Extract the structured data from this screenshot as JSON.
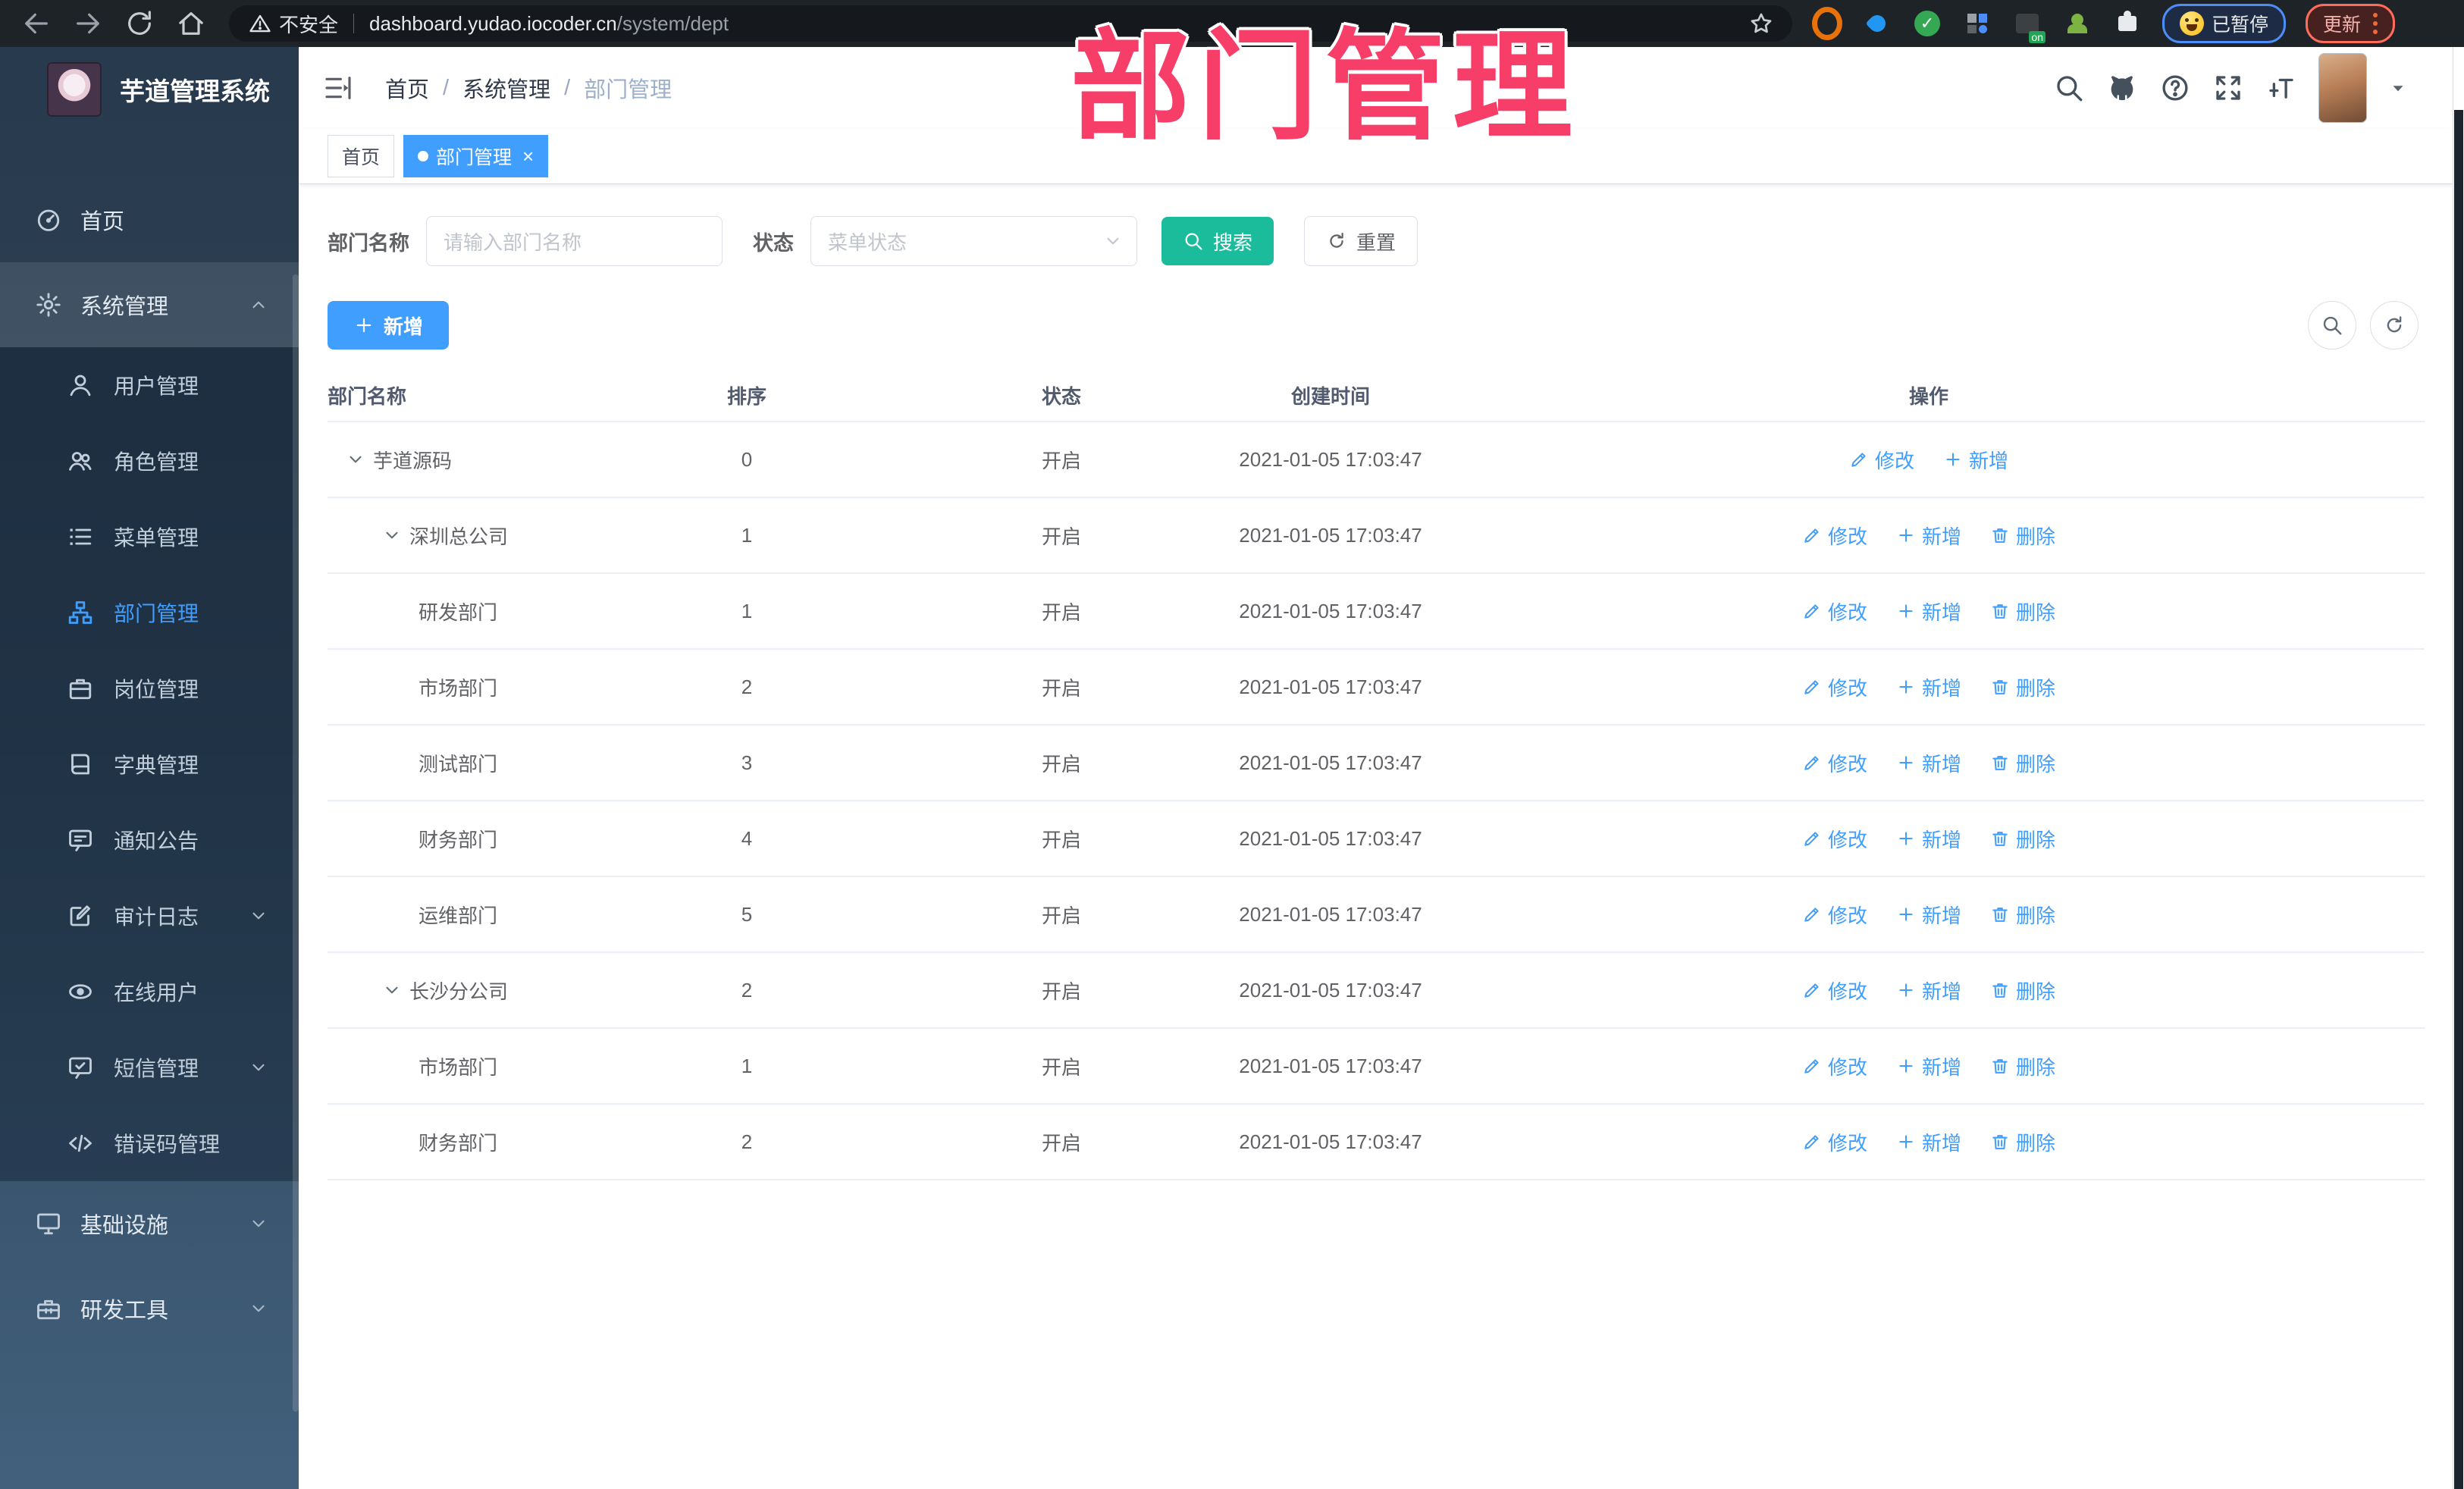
{
  "browser": {
    "security_label": "不安全",
    "url_host": "dashboard.yudao.iocoder.cn",
    "url_path": "/system/dept",
    "profile_chip_label": "已暂停",
    "update_button_label": "更新",
    "extensions": [
      {
        "name": "target-extension-icon",
        "kind": "target",
        "color": "#e8710a"
      },
      {
        "name": "drop-extension-icon",
        "kind": "drop",
        "color": "#2196f3"
      },
      {
        "name": "check-circle-extension-icon",
        "kind": "check",
        "color": "#34a853"
      },
      {
        "name": "grid-extension-icon",
        "kind": "grid",
        "color": "#9aa0a6"
      },
      {
        "name": "switch-extension-icon",
        "kind": "onbadge",
        "badge": "on",
        "color": "#21a453"
      },
      {
        "name": "person-extension-icon",
        "kind": "person",
        "color": "#7cb342"
      },
      {
        "name": "puzzle-extension-icon",
        "kind": "puzzle",
        "color": "#e8eaed"
      }
    ]
  },
  "annotation": {
    "text": "部门管理",
    "color": "#f63e68"
  },
  "sidebar": {
    "title": "芋道管理系统",
    "items": [
      {
        "label": "首页",
        "icon": "dashboard",
        "type": "root"
      },
      {
        "label": "系统管理",
        "icon": "gear",
        "type": "root",
        "section": true,
        "chevron": "up"
      },
      {
        "label": "用户管理",
        "icon": "user",
        "type": "sub"
      },
      {
        "label": "角色管理",
        "icon": "users",
        "type": "sub"
      },
      {
        "label": "菜单管理",
        "icon": "menulist",
        "type": "sub"
      },
      {
        "label": "部门管理",
        "icon": "orgtree",
        "type": "sub",
        "active": true
      },
      {
        "label": "岗位管理",
        "icon": "briefcase",
        "type": "sub"
      },
      {
        "label": "字典管理",
        "icon": "book",
        "type": "sub"
      },
      {
        "label": "通知公告",
        "icon": "chat",
        "type": "sub"
      },
      {
        "label": "审计日志",
        "icon": "edit",
        "type": "sub",
        "chevron": "down"
      },
      {
        "label": "在线用户",
        "icon": "eye",
        "type": "sub"
      },
      {
        "label": "短信管理",
        "icon": "sms",
        "type": "sub",
        "chevron": "down"
      },
      {
        "label": "错误码管理",
        "icon": "code",
        "type": "sub"
      },
      {
        "label": "基础设施",
        "icon": "monitor",
        "type": "root",
        "chevron": "down"
      },
      {
        "label": "研发工具",
        "icon": "toolbox",
        "type": "root",
        "chevron": "down"
      }
    ]
  },
  "header": {
    "breadcrumb": [
      "首页",
      "系统管理",
      "部门管理"
    ],
    "icons": [
      {
        "name": "search-icon",
        "icon": "search"
      },
      {
        "name": "github-icon",
        "icon": "github"
      },
      {
        "name": "help-icon",
        "icon": "help"
      },
      {
        "name": "fullscreen-icon",
        "icon": "fullscreen"
      },
      {
        "name": "font-size-icon",
        "icon": "fontsize"
      }
    ]
  },
  "tabs": [
    {
      "label": "首页",
      "active": false
    },
    {
      "label": "部门管理",
      "active": true,
      "closable": true
    }
  ],
  "filter": {
    "name_label": "部门名称",
    "name_placeholder": "请输入部门名称",
    "status_label": "状态",
    "status_placeholder": "菜单状态",
    "search_label": "搜索",
    "reset_label": "重置"
  },
  "toolbar": {
    "add_label": "新增"
  },
  "table": {
    "columns": [
      "部门名称",
      "排序",
      "状态",
      "创建时间",
      "操作"
    ],
    "action_labels": {
      "edit": "修改",
      "add": "新增",
      "del": "删除"
    },
    "rows": [
      {
        "name": "芋道源码",
        "level": 0,
        "expandable": true,
        "sort": "0",
        "status": "开启",
        "created": "2021-01-05 17:03:47",
        "actions": [
          "edit",
          "add"
        ]
      },
      {
        "name": "深圳总公司",
        "level": 1,
        "expandable": true,
        "sort": "1",
        "status": "开启",
        "created": "2021-01-05 17:03:47",
        "actions": [
          "edit",
          "add",
          "del"
        ]
      },
      {
        "name": "研发部门",
        "level": 2,
        "expandable": false,
        "sort": "1",
        "status": "开启",
        "created": "2021-01-05 17:03:47",
        "actions": [
          "edit",
          "add",
          "del"
        ]
      },
      {
        "name": "市场部门",
        "level": 2,
        "expandable": false,
        "sort": "2",
        "status": "开启",
        "created": "2021-01-05 17:03:47",
        "actions": [
          "edit",
          "add",
          "del"
        ]
      },
      {
        "name": "测试部门",
        "level": 2,
        "expandable": false,
        "sort": "3",
        "status": "开启",
        "created": "2021-01-05 17:03:47",
        "actions": [
          "edit",
          "add",
          "del"
        ]
      },
      {
        "name": "财务部门",
        "level": 2,
        "expandable": false,
        "sort": "4",
        "status": "开启",
        "created": "2021-01-05 17:03:47",
        "actions": [
          "edit",
          "add",
          "del"
        ]
      },
      {
        "name": "运维部门",
        "level": 2,
        "expandable": false,
        "sort": "5",
        "status": "开启",
        "created": "2021-01-05 17:03:47",
        "actions": [
          "edit",
          "add",
          "del"
        ]
      },
      {
        "name": "长沙分公司",
        "level": 1,
        "expandable": true,
        "sort": "2",
        "status": "开启",
        "created": "2021-01-05 17:03:47",
        "actions": [
          "edit",
          "add",
          "del"
        ]
      },
      {
        "name": "市场部门",
        "level": 2,
        "expandable": false,
        "sort": "1",
        "status": "开启",
        "created": "2021-01-05 17:03:47",
        "actions": [
          "edit",
          "add",
          "del"
        ]
      },
      {
        "name": "财务部门",
        "level": 2,
        "expandable": false,
        "sort": "2",
        "status": "开启",
        "created": "2021-01-05 17:03:47",
        "actions": [
          "edit",
          "add",
          "del"
        ]
      }
    ]
  },
  "colors": {
    "primary": "#409eff",
    "search_button": "#1abc9c",
    "annotation_pink": "#f63e68",
    "sidebar_dark": "#2e4459",
    "active_link": "#409eff"
  }
}
